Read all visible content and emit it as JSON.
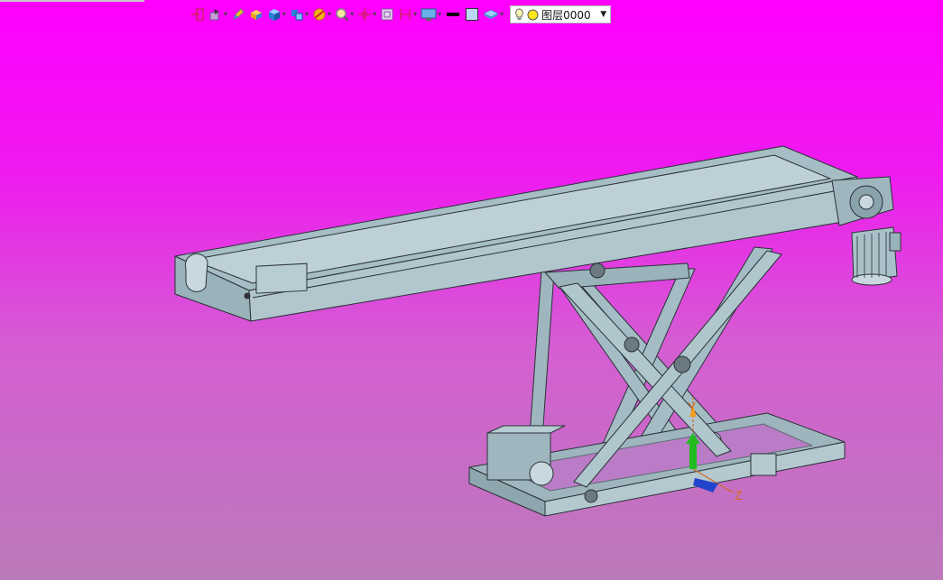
{
  "toolbar": {
    "buttons": [
      {
        "name": "exit-icon",
        "has_menu": false
      },
      {
        "name": "snap-select-icon",
        "has_menu": true
      },
      {
        "name": "sketch-pen-icon",
        "has_menu": false
      },
      {
        "name": "solid-box-icon",
        "has_menu": false
      },
      {
        "name": "render-cube-icon",
        "has_menu": true
      },
      {
        "name": "view-orient-icon",
        "has_menu": true
      },
      {
        "name": "section-view-icon",
        "has_menu": true
      },
      {
        "name": "zoom-icon",
        "has_menu": true
      },
      {
        "name": "move-axis-icon",
        "has_menu": true
      },
      {
        "name": "fit-frame-icon",
        "has_menu": false
      },
      {
        "name": "dimension-icon",
        "has_menu": true
      },
      {
        "name": "display-monitor-icon",
        "has_menu": true
      },
      {
        "name": "line-color-icon",
        "has_menu": false
      },
      {
        "name": "fill-color-icon",
        "has_menu": false
      },
      {
        "name": "layer-stack-icon",
        "has_menu": true
      }
    ],
    "layer": {
      "icons": [
        "bulb-icon",
        "yellow-circle-icon"
      ],
      "name": "图层0000"
    }
  },
  "viewport": {
    "axis_labels": {
      "y": "Y",
      "z": "Z"
    }
  },
  "colors": {
    "background_top": "#ff00ff",
    "background_bottom": "#bb7ab9",
    "model_face": "#a9c0c8",
    "model_edge": "#2a3238",
    "axis_y": "#22bb22",
    "axis_z": "#2244cc",
    "axis_label": "#d2691e"
  }
}
